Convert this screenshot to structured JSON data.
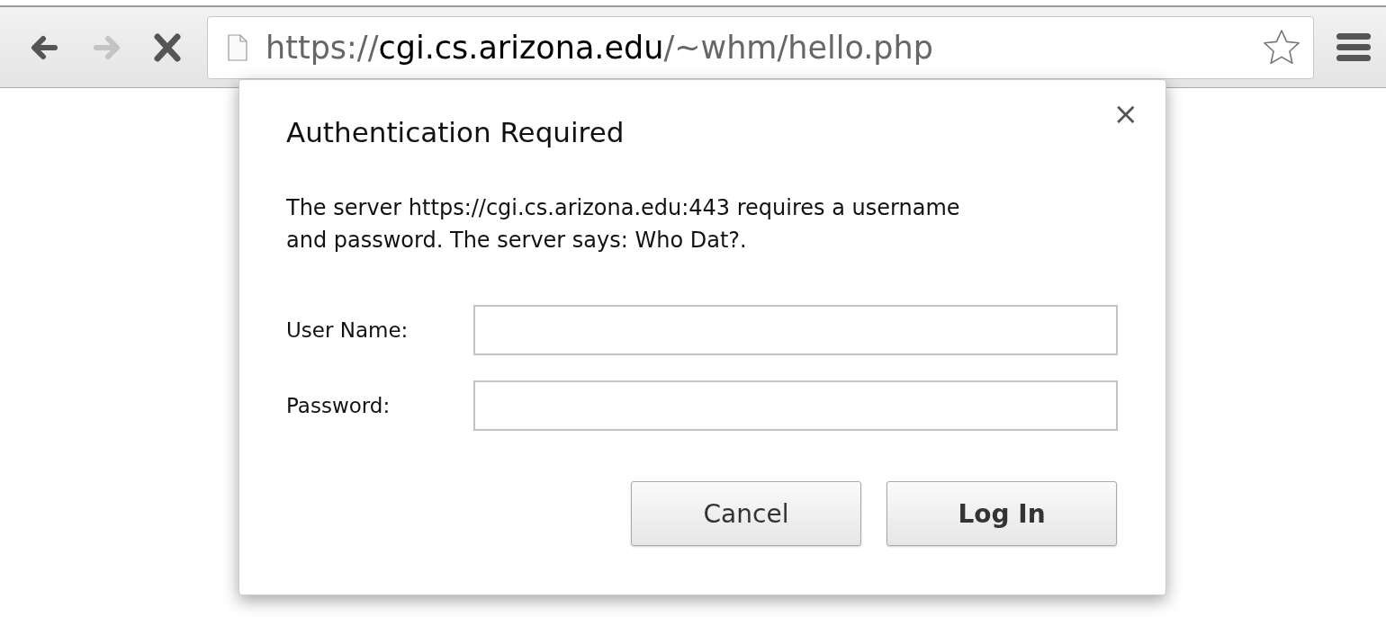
{
  "toolbar": {
    "buttons": [
      {
        "kind": "back",
        "disabled": false
      },
      {
        "kind": "forward",
        "disabled": true
      },
      {
        "kind": "stop",
        "disabled": false
      }
    ],
    "address": {
      "url": "https://**cgi.cs.arizona.edu**/~whm/hello.php",
      "bookmarked": false
    }
  },
  "dialog": {
    "title": "Authentication Required",
    "close": "×",
    "message": "The server https://cgi.cs.arizona.edu:443 requires a username and password. The server says: Who Dat?.",
    "fields": [
      {
        "label": "User Name:"
      },
      {
        "label": "Password:"
      }
    ],
    "buttons": [
      {
        "label": "Cancel",
        "default": false
      },
      {
        "label": "Log In",
        "default": true
      }
    ]
  }
}
